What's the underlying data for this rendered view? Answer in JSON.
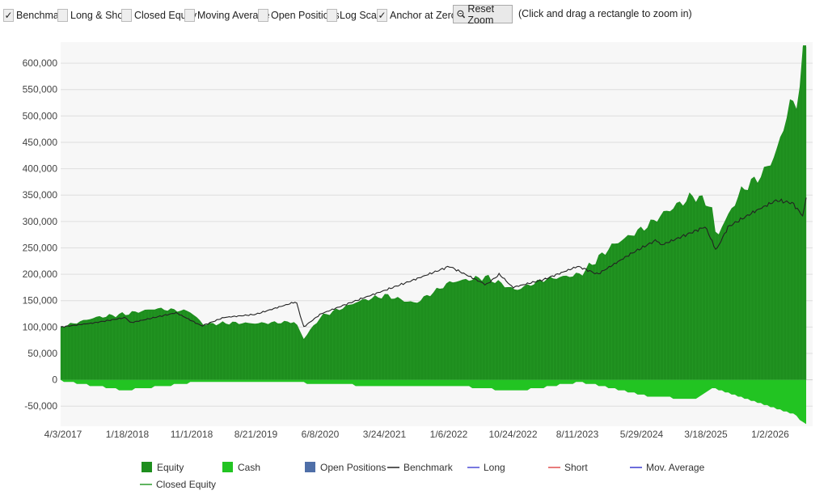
{
  "toolbar": {
    "options": [
      {
        "label": "Benchmark",
        "checked": true
      },
      {
        "label": "Long & Short",
        "checked": false
      },
      {
        "label": "Closed Equity",
        "checked": false
      },
      {
        "label": "Moving Average",
        "checked": false
      },
      {
        "label": "Open Positions",
        "checked": false
      },
      {
        "label": "Log Scale",
        "checked": false
      },
      {
        "label": "Anchor at Zero",
        "checked": true
      }
    ],
    "reset_label": "Reset Zoom",
    "hint": "(Click and drag a rectangle to zoom in)",
    "check_glyph": "✓"
  },
  "chart_data": {
    "type": "area",
    "x_tick_labels": [
      "4/3/2017",
      "1/18/2018",
      "11/1/2018",
      "8/21/2019",
      "6/8/2020",
      "3/24/2021",
      "1/6/2022",
      "10/24/2022",
      "8/11/2023",
      "5/29/2024",
      "3/18/2025",
      "1/2/2026"
    ],
    "y_tick_labels": [
      "-50,000",
      "0",
      "50,000",
      "100,000",
      "150,000",
      "200,000",
      "250,000",
      "300,000",
      "350,000",
      "400,000",
      "450,000",
      "500,000",
      "550,000",
      "600,000"
    ],
    "ylim": [
      -88000,
      640000
    ],
    "xlim": [
      "2017-04-03",
      "2026-05-15"
    ],
    "grid": true,
    "legend_position": "bottom",
    "colors": {
      "equity": "#1e8e1e",
      "cash": "#22c422",
      "open_positions": "#4f6fa8",
      "benchmark": "#222222",
      "long": "#4c4cd6",
      "short": "#e05050",
      "mov_average": "#3a3ad0",
      "closed_equity": "#2a9a2a"
    },
    "legend": [
      {
        "name": "Equity",
        "kind": "box",
        "color_key": "equity"
      },
      {
        "name": "Cash",
        "kind": "box",
        "color_key": "cash"
      },
      {
        "name": "Open Positions",
        "kind": "box",
        "color_key": "open_positions"
      },
      {
        "name": "Benchmark",
        "kind": "line",
        "color_key": "benchmark"
      },
      {
        "name": "Long",
        "kind": "line",
        "color_key": "long"
      },
      {
        "name": "Short",
        "kind": "line",
        "color_key": "short"
      },
      {
        "name": "Mov. Average",
        "kind": "line",
        "color_key": "mov_average"
      },
      {
        "name": "Closed Equity",
        "kind": "line",
        "color_key": "closed_equity"
      }
    ],
    "series": [
      {
        "name": "Equity",
        "dates": [
          "2017-04-03",
          "2017-09-01",
          "2018-01-18",
          "2018-06-01",
          "2018-11-01",
          "2019-01-01",
          "2019-05-01",
          "2019-08-21",
          "2020-02-15",
          "2020-03-23",
          "2020-06-08",
          "2020-12-01",
          "2021-03-24",
          "2021-08-01",
          "2022-01-06",
          "2022-06-15",
          "2022-10-24",
          "2023-03-01",
          "2023-08-11",
          "2024-01-01",
          "2024-05-29",
          "2024-09-01",
          "2025-01-01",
          "2025-03-18",
          "2025-04-08",
          "2025-08-01",
          "2025-11-01",
          "2026-01-02",
          "2026-03-01",
          "2026-04-10",
          "2026-05-05",
          "2026-05-15"
        ],
        "values": [
          100000,
          118000,
          125000,
          135000,
          130000,
          105000,
          108000,
          107000,
          110000,
          78000,
          120000,
          150000,
          160000,
          145000,
          185000,
          195000,
          170000,
          190000,
          200000,
          255000,
          290000,
          320000,
          350000,
          330000,
          270000,
          360000,
          390000,
          430000,
          520000,
          530000,
          635000,
          640000
        ]
      },
      {
        "name": "Cash",
        "dates": [
          "2017-04-03",
          "2018-01-18",
          "2019-01-01",
          "2020-03-01",
          "2020-06-08",
          "2021-03-24",
          "2022-01-06",
          "2022-10-24",
          "2023-08-11",
          "2024-05-29",
          "2025-01-01",
          "2025-03-18",
          "2026-01-02",
          "2026-04-01",
          "2026-05-15"
        ],
        "values": [
          -2000,
          -20000,
          -3000,
          -5000,
          -8000,
          -12000,
          -10000,
          -22000,
          -4000,
          -30000,
          -38000,
          -15000,
          -55000,
          -68000,
          -86000
        ]
      },
      {
        "name": "Benchmark",
        "dates": [
          "2017-04-03",
          "2017-09-01",
          "2018-01-18",
          "2018-02-09",
          "2018-09-01",
          "2018-12-24",
          "2019-04-01",
          "2019-08-21",
          "2020-02-19",
          "2020-03-23",
          "2020-06-08",
          "2020-12-01",
          "2021-03-24",
          "2021-08-01",
          "2022-01-03",
          "2022-06-16",
          "2022-08-15",
          "2022-10-12",
          "2023-03-01",
          "2023-07-31",
          "2023-10-27",
          "2024-03-28",
          "2024-07-16",
          "2024-08-05",
          "2025-02-19",
          "2025-04-08",
          "2025-06-01",
          "2025-10-01",
          "2026-01-02",
          "2026-03-15",
          "2026-05-01",
          "2026-05-15"
        ],
        "values": [
          100000,
          108000,
          118000,
          108000,
          127000,
          102000,
          118000,
          124000,
          148000,
          100000,
          125000,
          153000,
          170000,
          190000,
          215000,
          180000,
          200000,
          175000,
          190000,
          215000,
          200000,
          240000,
          265000,
          255000,
          290000,
          245000,
          290000,
          320000,
          340000,
          335000,
          310000,
          345000
        ]
      }
    ]
  }
}
